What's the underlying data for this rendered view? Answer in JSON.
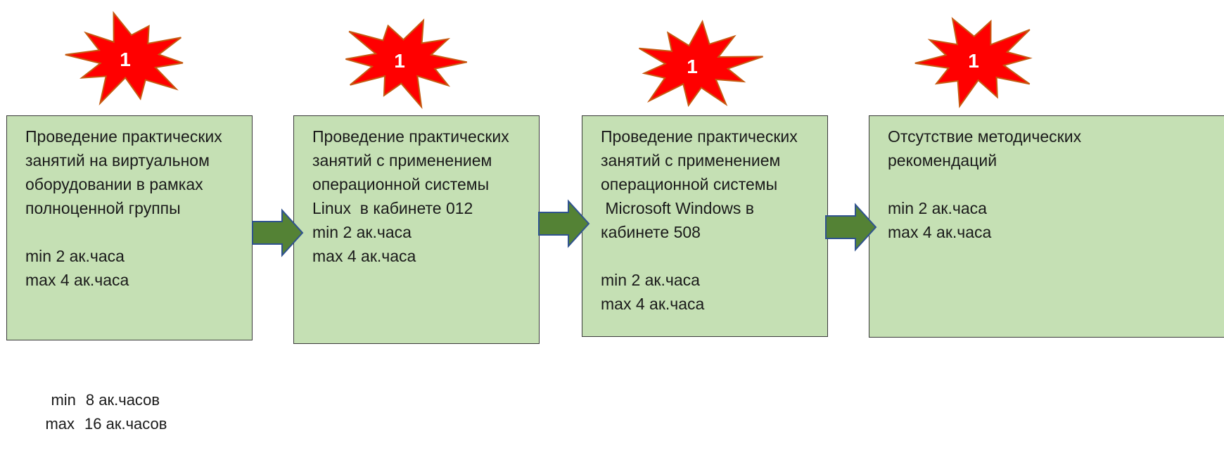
{
  "colors": {
    "burst_fill": "#ff0000",
    "burst_stroke": "#c55a11",
    "burst_text": "#ffffff",
    "box_fill": "#c5e0b4",
    "arrow_fill": "#548235",
    "arrow_stroke": "#2f528f"
  },
  "bursts": [
    {
      "label": "1"
    },
    {
      "label": "1"
    },
    {
      "label": "1"
    },
    {
      "label": "1"
    }
  ],
  "boxes": [
    {
      "lines": [
        "Проведение практических",
        "занятий на виртуальном",
        "оборудовании в рамках",
        "полноценной группы",
        "",
        "min 2 ак.часа",
        "max 4 ак.часа"
      ]
    },
    {
      "lines": [
        "Проведение практических",
        "занятий с применением",
        "операционной системы",
        "Linux  в кабинете 012",
        "min 2 ак.часа",
        "max 4 ак.часа"
      ]
    },
    {
      "lines": [
        "Проведение практических",
        "занятий с применением",
        "операционной системы",
        " Microsoft Windows в",
        "кабинете 508",
        "",
        "min 2 ак.часа",
        "max 4 ак.часа"
      ]
    },
    {
      "lines": [
        "Отсутствие методических",
        "рекомендаций",
        "",
        "min 2 ак.часа",
        "max 4 ак.часа"
      ]
    }
  ],
  "arrows": [
    {
      "icon": "right-arrow-icon"
    },
    {
      "icon": "right-arrow-icon"
    },
    {
      "icon": "right-arrow-icon"
    }
  ],
  "totals": [
    {
      "label": "min",
      "value": "8 ак.часов"
    },
    {
      "label": "max",
      "value": "16 ак.часов"
    }
  ]
}
